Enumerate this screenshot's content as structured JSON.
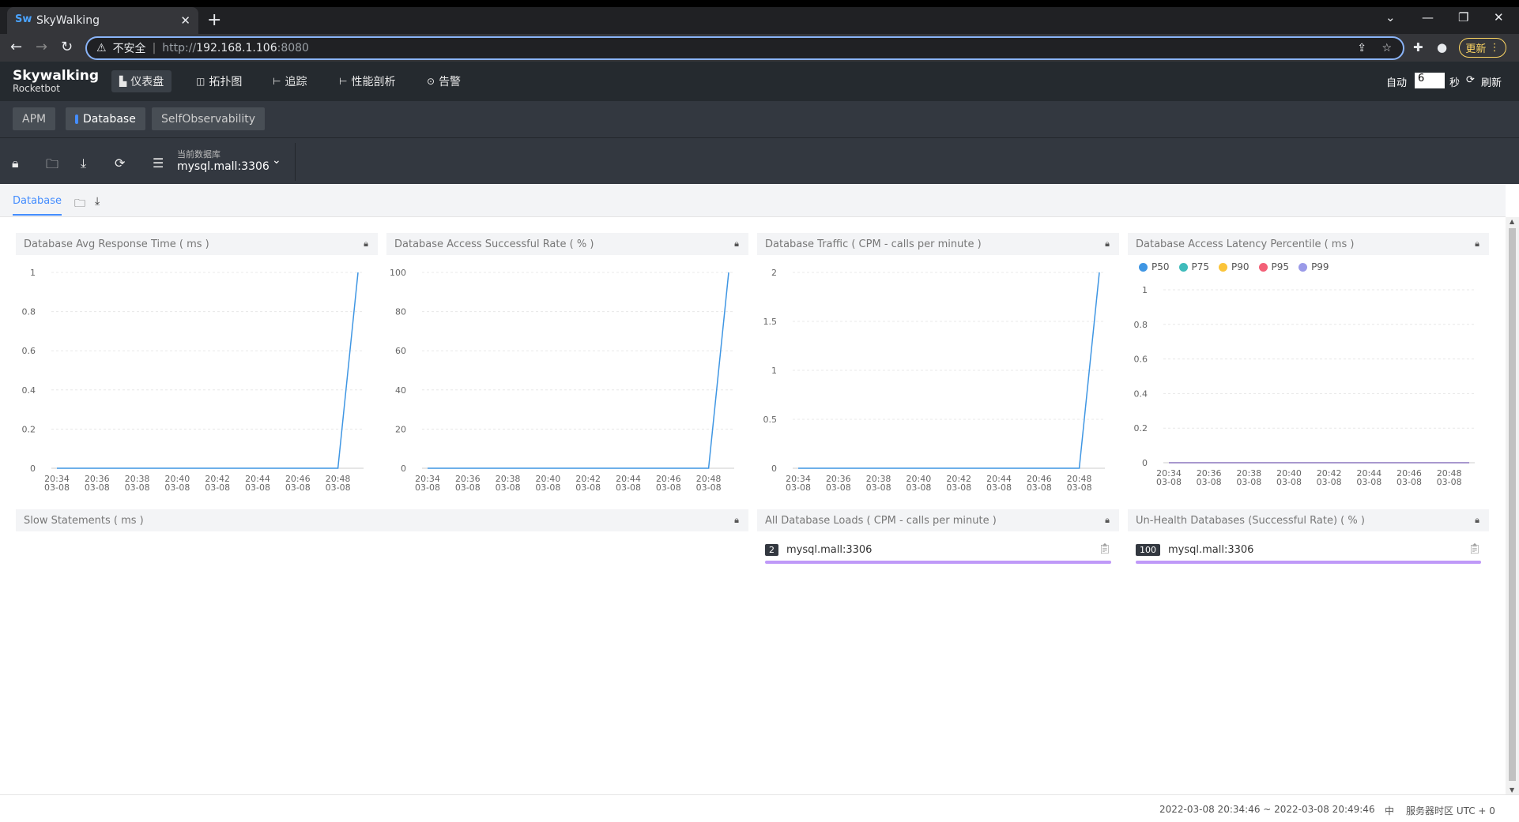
{
  "browser": {
    "tab_title": "SkyWalking",
    "favicon": "Sw",
    "security_label": "不安全",
    "url_scheme": "http://",
    "url_host": "192.168.1.106",
    "url_port": ":8080",
    "update_label": "更新"
  },
  "app": {
    "logo_main": "Skywalking",
    "logo_sub": "Rocketbot",
    "nav": [
      {
        "label": "仪表盘",
        "icon": "dashboard-icon",
        "active": true
      },
      {
        "label": "拓扑图",
        "icon": "topology-icon",
        "active": false
      },
      {
        "label": "追踪",
        "icon": "trace-icon",
        "active": false
      },
      {
        "label": "性能剖析",
        "icon": "profile-icon",
        "active": false
      },
      {
        "label": "告警",
        "icon": "alarm-icon",
        "active": false
      }
    ],
    "auto_label": "自动",
    "auto_seconds": "6",
    "seconds_unit": "秒",
    "refresh_label": "刷新"
  },
  "subtabs": [
    "APM",
    "Database",
    "SelfObservability"
  ],
  "toolbar": {
    "db_label": "当前数据库",
    "db_value": "mysql.mall:3306"
  },
  "dashboard_tab": "Database",
  "x_ticks": [
    [
      "20:34",
      "03-08"
    ],
    [
      "20:36",
      "03-08"
    ],
    [
      "20:38",
      "03-08"
    ],
    [
      "20:40",
      "03-08"
    ],
    [
      "20:42",
      "03-08"
    ],
    [
      "20:44",
      "03-08"
    ],
    [
      "20:46",
      "03-08"
    ],
    [
      "20:48",
      "03-08"
    ]
  ],
  "panels": {
    "p1": {
      "title": "Database Avg Response Time ( ms )"
    },
    "p2": {
      "title": "Database Access Successful Rate ( % )"
    },
    "p3": {
      "title": "Database Traffic ( CPM - calls per minute )"
    },
    "p4": {
      "title": "Database Access Latency Percentile ( ms )"
    },
    "p5": {
      "title": "Slow Statements ( ms )"
    },
    "p6": {
      "title": "All Database Loads ( CPM - calls per minute )",
      "rows": [
        {
          "value": "2",
          "name": "mysql.mall:3306"
        }
      ]
    },
    "p7": {
      "title": "Un-Health Databases (Successful Rate) ( % )",
      "rows": [
        {
          "value": "100",
          "name": "mysql.mall:3306"
        }
      ]
    }
  },
  "chart_data": [
    {
      "type": "line",
      "x": [
        "20:34",
        "20:35",
        "20:36",
        "20:37",
        "20:38",
        "20:39",
        "20:40",
        "20:41",
        "20:42",
        "20:43",
        "20:44",
        "20:45",
        "20:46",
        "20:47",
        "20:48",
        "20:49"
      ],
      "series": [
        {
          "values": [
            0,
            0,
            0,
            0,
            0,
            0,
            0,
            0,
            0,
            0,
            0,
            0,
            0,
            0,
            0,
            1
          ]
        }
      ],
      "yticks": [
        "0",
        "0.2",
        "0.4",
        "0.6",
        "0.8",
        "1"
      ],
      "ylim": [
        0,
        1
      ],
      "color": "#3f96e3"
    },
    {
      "type": "line",
      "x": [
        "20:34",
        "20:35",
        "20:36",
        "20:37",
        "20:38",
        "20:39",
        "20:40",
        "20:41",
        "20:42",
        "20:43",
        "20:44",
        "20:45",
        "20:46",
        "20:47",
        "20:48",
        "20:49"
      ],
      "series": [
        {
          "values": [
            0,
            0,
            0,
            0,
            0,
            0,
            0,
            0,
            0,
            0,
            0,
            0,
            0,
            0,
            0,
            100
          ]
        }
      ],
      "yticks": [
        "0",
        "20",
        "40",
        "60",
        "80",
        "100"
      ],
      "ylim": [
        0,
        100
      ],
      "color": "#3f96e3"
    },
    {
      "type": "line",
      "x": [
        "20:34",
        "20:35",
        "20:36",
        "20:37",
        "20:38",
        "20:39",
        "20:40",
        "20:41",
        "20:42",
        "20:43",
        "20:44",
        "20:45",
        "20:46",
        "20:47",
        "20:48",
        "20:49"
      ],
      "series": [
        {
          "values": [
            0,
            0,
            0,
            0,
            0,
            0,
            0,
            0,
            0,
            0,
            0,
            0,
            0,
            0,
            0,
            2
          ]
        }
      ],
      "yticks": [
        "0",
        "0.5",
        "1",
        "1.5",
        "2"
      ],
      "ylim": [
        0,
        2
      ],
      "color": "#3f96e3"
    },
    {
      "type": "line",
      "x": [
        "20:34",
        "20:35",
        "20:36",
        "20:37",
        "20:38",
        "20:39",
        "20:40",
        "20:41",
        "20:42",
        "20:43",
        "20:44",
        "20:45",
        "20:46",
        "20:47",
        "20:48",
        "20:49"
      ],
      "series": [
        {
          "name": "P50",
          "values": [
            0,
            0,
            0,
            0,
            0,
            0,
            0,
            0,
            0,
            0,
            0,
            0,
            0,
            0,
            0,
            0
          ],
          "color": "#3f96e3"
        },
        {
          "name": "P75",
          "values": [
            0,
            0,
            0,
            0,
            0,
            0,
            0,
            0,
            0,
            0,
            0,
            0,
            0,
            0,
            0,
            0
          ],
          "color": "#3fbbbb"
        },
        {
          "name": "P90",
          "values": [
            0,
            0,
            0,
            0,
            0,
            0,
            0,
            0,
            0,
            0,
            0,
            0,
            0,
            0,
            0,
            0
          ],
          "color": "#fbc43a"
        },
        {
          "name": "P95",
          "values": [
            0,
            0,
            0,
            0,
            0,
            0,
            0,
            0,
            0,
            0,
            0,
            0,
            0,
            0,
            0,
            0
          ],
          "color": "#f36077"
        },
        {
          "name": "P99",
          "values": [
            0,
            0,
            0,
            0,
            0,
            0,
            0,
            0,
            0,
            0,
            0,
            0,
            0,
            0,
            0,
            0
          ],
          "color": "#9a9ae8"
        }
      ],
      "yticks": [
        "0",
        "0.2",
        "0.4",
        "0.6",
        "0.8",
        "1"
      ],
      "ylim": [
        0,
        1
      ]
    }
  ],
  "footer": {
    "time_range": "2022-03-08 20:34:46 ~ 2022-03-08 20:49:46",
    "lang": "中",
    "timezone": "服务器时区 UTC + 0"
  }
}
